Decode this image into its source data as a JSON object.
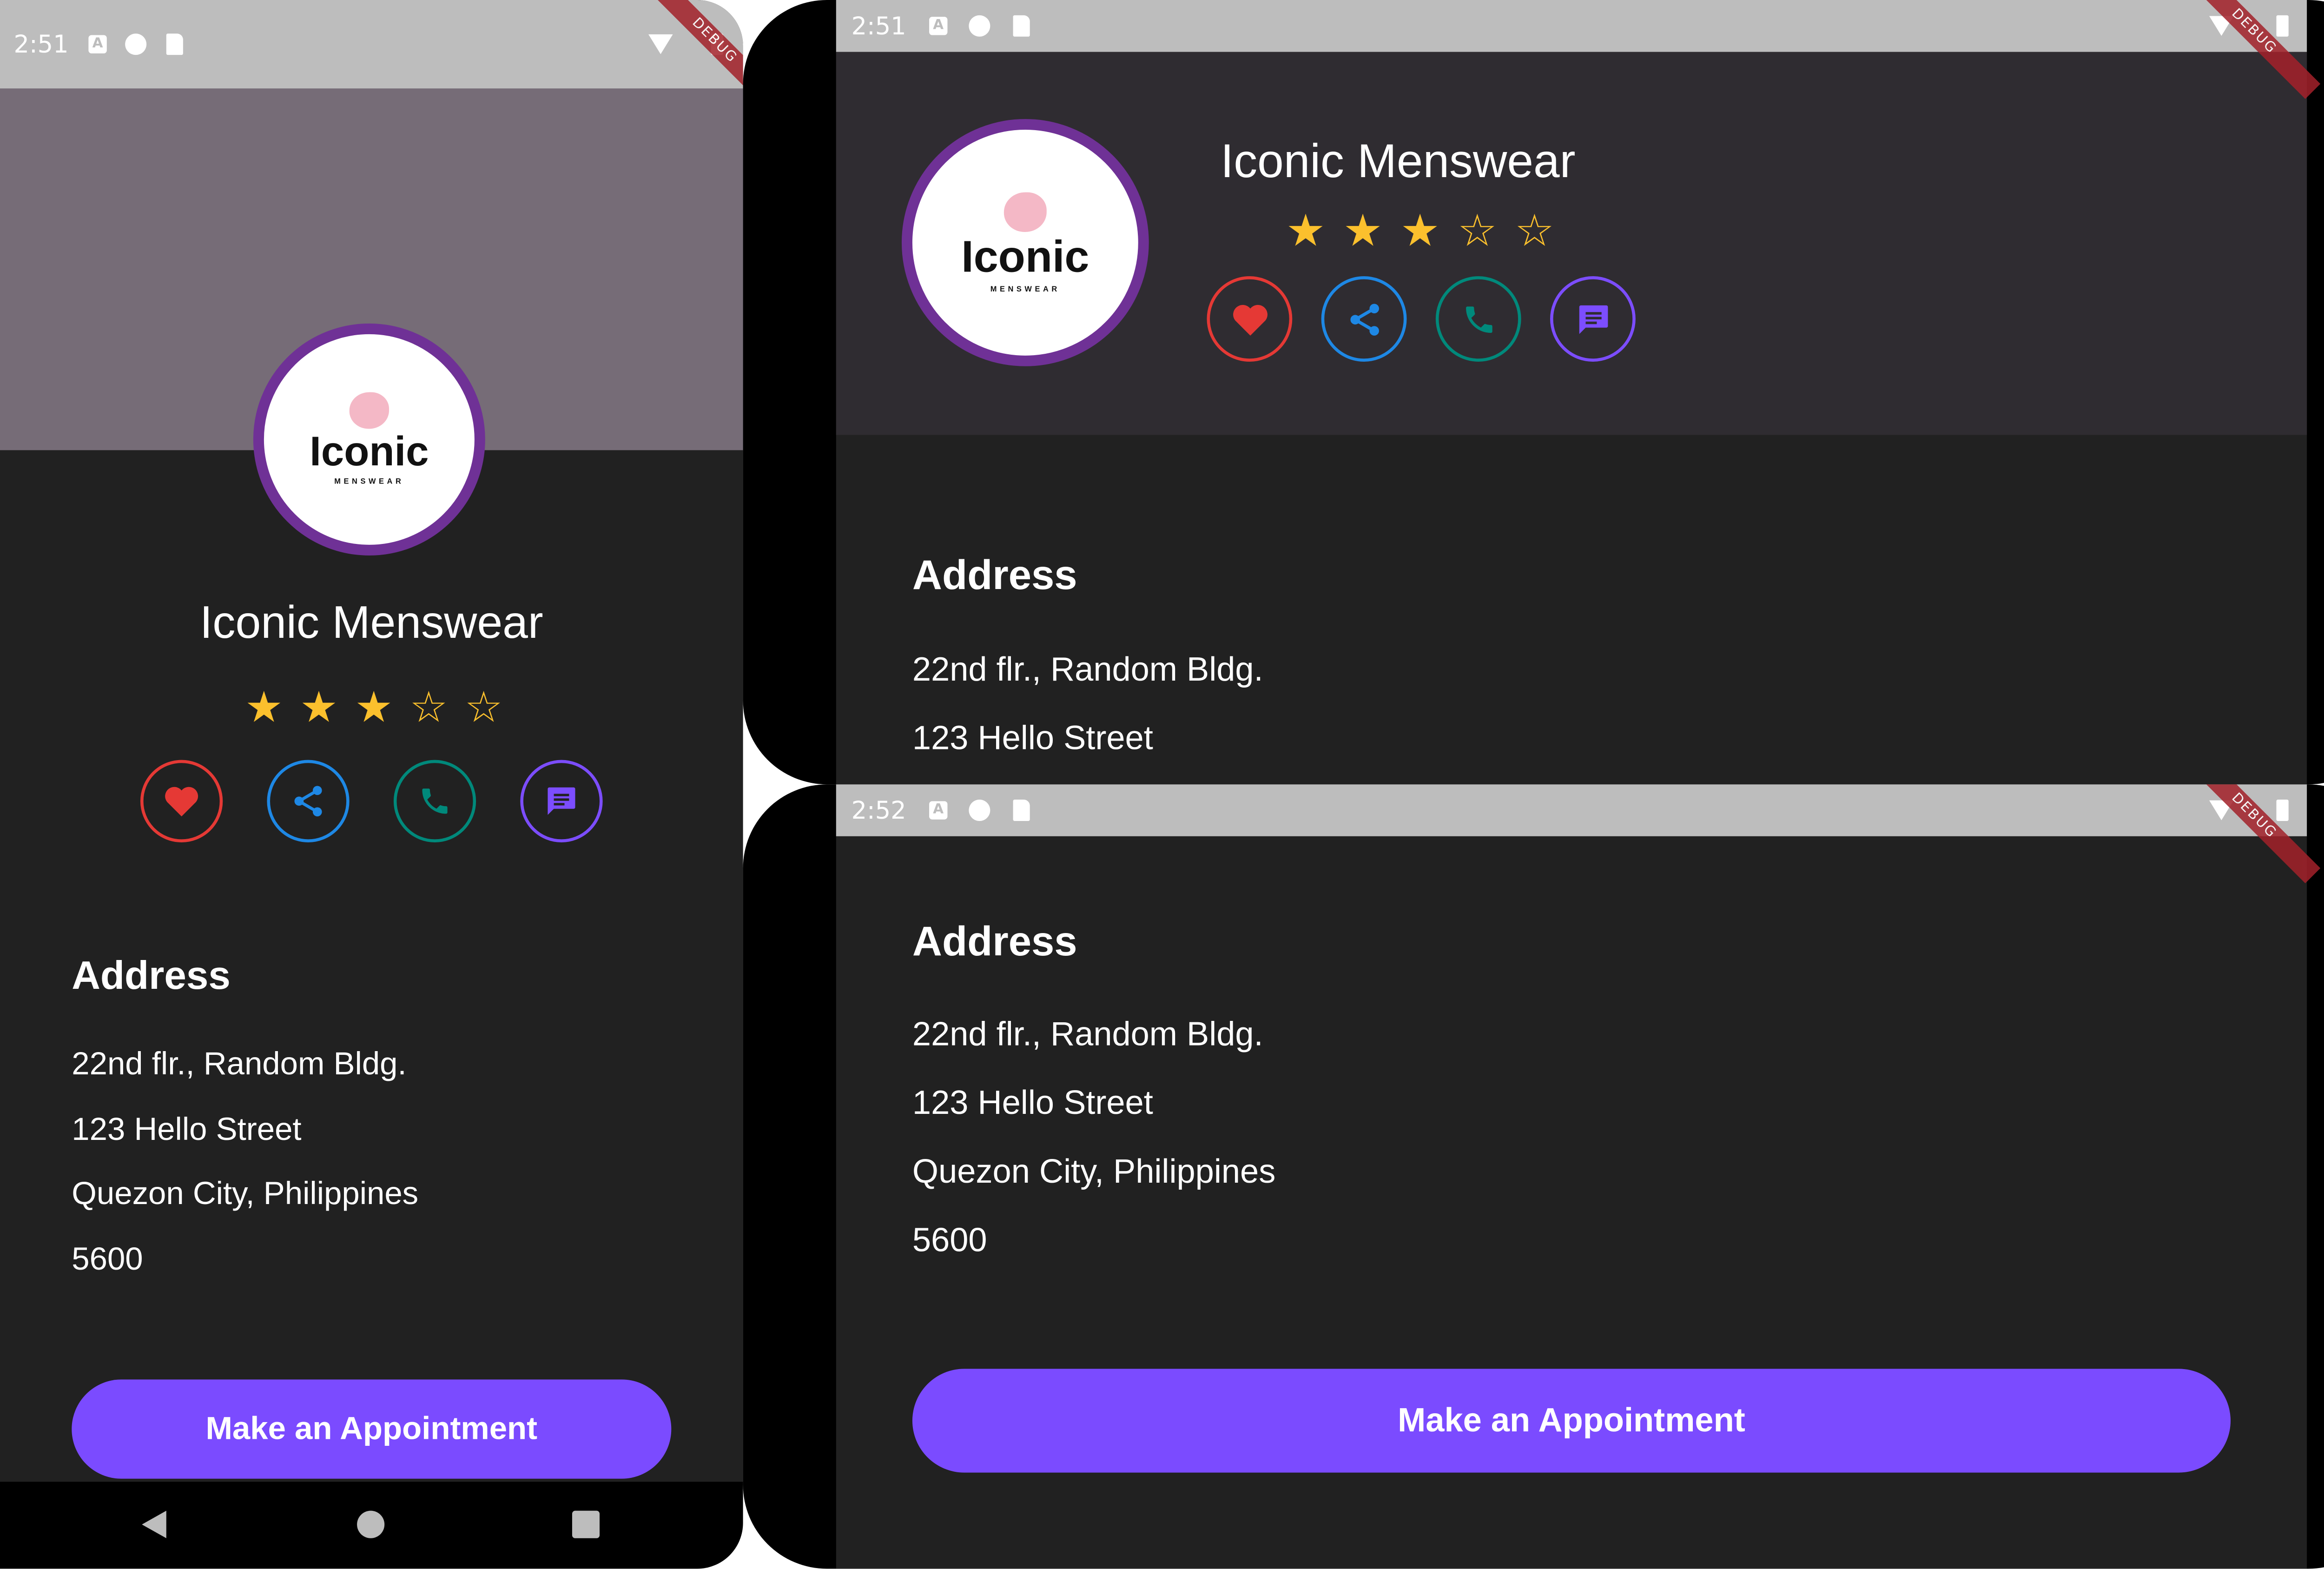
{
  "status_bar": {
    "time_a": "2:51",
    "time_b": "2:51",
    "time_c": "2:52"
  },
  "debug_banner": "DEBUG",
  "logo": {
    "word": "Iconic",
    "sub": "MENSWEAR"
  },
  "business": {
    "name": "Iconic Menswear",
    "rating": 3,
    "rating_max": 5
  },
  "actions": {
    "favorite": "favorite",
    "share": "share",
    "call": "call",
    "message": "message"
  },
  "address": {
    "heading": "Address",
    "line1": "22nd flr., Random Bldg.",
    "line2": "123 Hello Street",
    "line3": "Quezon City, Philippines",
    "line4": "5600"
  },
  "cta_label": "Make an Appointment",
  "colors": {
    "accent": "#7b4bff",
    "star": "#fbc02d",
    "favorite": "#e53935",
    "share": "#1e88e5",
    "call": "#00897b",
    "message": "#7c4dff",
    "ring": "#6f3196"
  },
  "icons": {
    "nav_back": "triangle-back-icon",
    "nav_home": "circle-home-icon",
    "nav_recents": "square-recents-icon"
  }
}
